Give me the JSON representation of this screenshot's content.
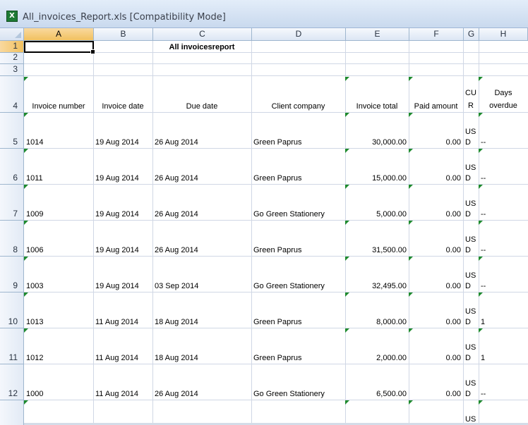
{
  "window": {
    "title": "All_invoices_Report.xls  [Compatibility Mode]",
    "app_icon": "excel-icon"
  },
  "columns": [
    "A",
    "B",
    "C",
    "D",
    "E",
    "F",
    "G",
    "H"
  ],
  "row_numbers": [
    "1",
    "2",
    "3",
    "4",
    "5",
    "6",
    "7",
    "8",
    "9",
    "10",
    "11",
    "12"
  ],
  "active_cell": "A1",
  "report_title": "All invoicesreport",
  "headers": {
    "invoice_number": "Invoice number",
    "invoice_date": "Invoice date",
    "due_date": "Due date",
    "client_company": "Client company",
    "invoice_total": "Invoice total",
    "paid_amount": "Paid amount",
    "cur_top": "CU",
    "cur_bottom": "R",
    "days_top": "Days",
    "days_bottom": "overdue"
  },
  "rows": [
    {
      "invoice_number": "1014",
      "invoice_date": "19 Aug 2014",
      "due_date": "26 Aug 2014",
      "client": "Green Paprus",
      "total": "30,000.00",
      "paid": "0.00",
      "cur_top": "US",
      "cur_bottom": "D",
      "days": "--"
    },
    {
      "invoice_number": "1011",
      "invoice_date": "19 Aug 2014",
      "due_date": "26 Aug 2014",
      "client": "Green Paprus",
      "total": "15,000.00",
      "paid": "0.00",
      "cur_top": "US",
      "cur_bottom": "D",
      "days": "--"
    },
    {
      "invoice_number": "1009",
      "invoice_date": "19 Aug 2014",
      "due_date": "26 Aug 2014",
      "client": "Go Green Stationery",
      "total": "5,000.00",
      "paid": "0.00",
      "cur_top": "US",
      "cur_bottom": "D",
      "days": "--"
    },
    {
      "invoice_number": "1006",
      "invoice_date": "19 Aug 2014",
      "due_date": "26 Aug 2014",
      "client": "Green Paprus",
      "total": "31,500.00",
      "paid": "0.00",
      "cur_top": "US",
      "cur_bottom": "D",
      "days": "--"
    },
    {
      "invoice_number": "1003",
      "invoice_date": "19 Aug 2014",
      "due_date": "03 Sep 2014",
      "client": "Go Green Stationery",
      "total": "32,495.00",
      "paid": "0.00",
      "cur_top": "US",
      "cur_bottom": "D",
      "days": "--"
    },
    {
      "invoice_number": "1013",
      "invoice_date": "11 Aug 2014",
      "due_date": "18 Aug 2014",
      "client": "Green Paprus",
      "total": "8,000.00",
      "paid": "0.00",
      "cur_top": "US",
      "cur_bottom": "D",
      "days": "1"
    },
    {
      "invoice_number": "1012",
      "invoice_date": "11 Aug 2014",
      "due_date": "18 Aug 2014",
      "client": "Green Paprus",
      "total": "2,000.00",
      "paid": "0.00",
      "cur_top": "US",
      "cur_bottom": "D",
      "days": "1"
    },
    {
      "invoice_number": "1000",
      "invoice_date": "11 Aug 2014",
      "due_date": "26 Aug 2014",
      "client": "Go Green Stationery",
      "total": "6,500.00",
      "paid": "0.00",
      "cur_top": "US",
      "cur_bottom": "D",
      "days": "--"
    }
  ],
  "partial_row": {
    "cur_top": "US"
  },
  "colors": {
    "grid_line": "#d0d7e5",
    "header_bg": "#dce6f4",
    "active_header": "#f1c15f",
    "error_triangle": "#1e8a2e"
  }
}
